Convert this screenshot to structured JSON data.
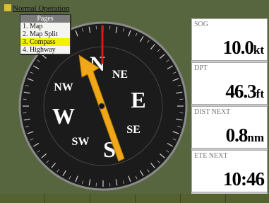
{
  "window": {
    "title": "Normal Operation"
  },
  "pages_menu": {
    "header": "Pages",
    "items": [
      {
        "label": "1. Map"
      },
      {
        "label": "2. Map Split"
      },
      {
        "label": "3. Compass"
      },
      {
        "label": "4. Highway"
      }
    ],
    "selected_index": 2
  },
  "compass": {
    "cardinals": [
      "N",
      "E",
      "S",
      "W"
    ],
    "intercardinals": [
      "NE",
      "SE",
      "SW",
      "NW"
    ],
    "heading_deg": 337,
    "colors": {
      "dial": "#1b1b1b",
      "pointer": "#f0a818",
      "lubber_line": "#d81818"
    }
  },
  "data_fields": [
    {
      "label": "SOG",
      "value": "10.0",
      "unit": "kt"
    },
    {
      "label": "DPT",
      "value": "46.3",
      "unit": "ft"
    },
    {
      "label": "DIST NEXT",
      "value": "0.8",
      "unit": "nm"
    },
    {
      "label": "ETE NEXT",
      "value": "10:46",
      "unit": ""
    }
  ]
}
